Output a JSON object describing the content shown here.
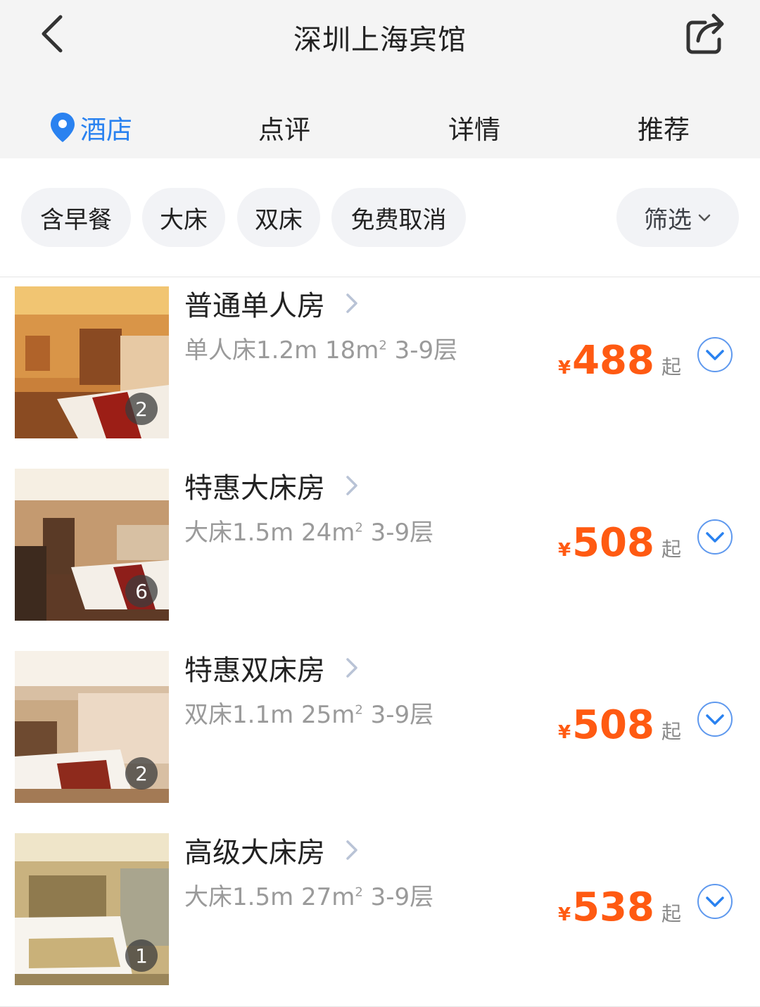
{
  "header": {
    "title": "深圳上海宾馆",
    "back_icon": "chevron-left-icon",
    "share_icon": "share-icon"
  },
  "tabs": [
    {
      "label": "酒店",
      "active": true,
      "icon": "location-pin-icon"
    },
    {
      "label": "点评",
      "active": false
    },
    {
      "label": "详情",
      "active": false
    },
    {
      "label": "推荐",
      "active": false
    }
  ],
  "filters": {
    "chips": [
      "含早餐",
      "大床",
      "双床",
      "免费取消"
    ],
    "filter_label": "筛选",
    "filter_icon": "chevron-down-icon"
  },
  "rooms": [
    {
      "name": "普通单人房",
      "info_main": "单人床1.2m 18m",
      "info_sup": "2",
      "info_tail": " 3-9层",
      "price_currency": "¥",
      "price": "488",
      "price_suffix": "起",
      "photo_count": "2"
    },
    {
      "name": "特惠大床房",
      "info_main": "大床1.5m 24m",
      "info_sup": "2",
      "info_tail": " 3-9层",
      "price_currency": "¥",
      "price": "508",
      "price_suffix": "起",
      "photo_count": "6"
    },
    {
      "name": "特惠双床房",
      "info_main": "双床1.1m 25m",
      "info_sup": "2",
      "info_tail": " 3-9层",
      "price_currency": "¥",
      "price": "508",
      "price_suffix": "起",
      "photo_count": "2"
    },
    {
      "name": "高级大床房",
      "info_main": "大床1.5m 27m",
      "info_sup": "2",
      "info_tail": " 3-9层",
      "price_currency": "¥",
      "price": "538",
      "price_suffix": "起",
      "photo_count": "1"
    }
  ],
  "colors": {
    "accent": "#2a82f0",
    "price": "#ff5a12",
    "header_bg": "#f4f4f4",
    "chip_bg": "#f2f3f6"
  }
}
